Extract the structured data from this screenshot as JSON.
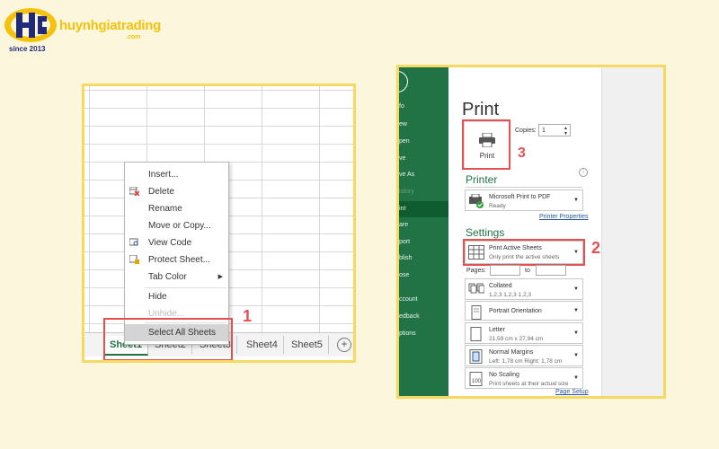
{
  "logo": {
    "brand": "huynhgiatrading",
    "domain": ".com",
    "since": "since 2013",
    "brand_color": "#f4c20d",
    "navy": "#1f2b7a"
  },
  "sheet_tabs": [
    "Sheet1",
    "Sheet2",
    "Sheet3",
    "Sheet4",
    "Sheet5"
  ],
  "context_menu": {
    "insert": "Insert...",
    "delete": "Delete",
    "rename": "Rename",
    "move_copy": "Move or Copy...",
    "view_code": "View Code",
    "protect_sheet": "Protect Sheet...",
    "tab_color": "Tab Color",
    "hide": "Hide",
    "unhide": "Unhide...",
    "select_all": "Select All Sheets"
  },
  "steps": {
    "one": "1",
    "two": "2",
    "three": "3"
  },
  "backstage_nav": {
    "info": "fo",
    "new": "ew",
    "open": "pen",
    "save": "ve",
    "save_as": "ve As",
    "history": "istory",
    "print": "int",
    "share": "are",
    "export": "port",
    "publish": "blish",
    "close": "ose",
    "account": "ccount",
    "feedback": "edback",
    "options": "ptions"
  },
  "print": {
    "title": "Print",
    "button_label": "Print",
    "copies_label": "Copies:",
    "copies_value": "1",
    "printer_heading": "Printer",
    "printer_name": "Microsoft Print to PDF",
    "printer_status": "Ready",
    "printer_properties": "Printer Properties",
    "settings_heading": "Settings",
    "active_sheets": "Print Active Sheets",
    "active_sheets_sub": "Only print the active sheets",
    "pages_label": "Pages:",
    "pages_to": "to",
    "collated": "Collated",
    "collated_sub": "1,2,3    1,2,3    1,2,3",
    "orientation": "Portrait Orientation",
    "paper": "Letter",
    "paper_sub": "21,59 cm x 27,94 cm",
    "margins": "Normal Margins",
    "margins_sub": "Left:  1,78 cm    Right:  1,78 cm",
    "scaling": "No Scaling",
    "scaling_sub": "Print sheets at their actual size",
    "page_setup": "Page Setup"
  },
  "colors": {
    "excel_green": "#217346",
    "highlight_red": "#e25050",
    "frame_yellow": "#f6d962",
    "background": "#fcf6dc"
  }
}
